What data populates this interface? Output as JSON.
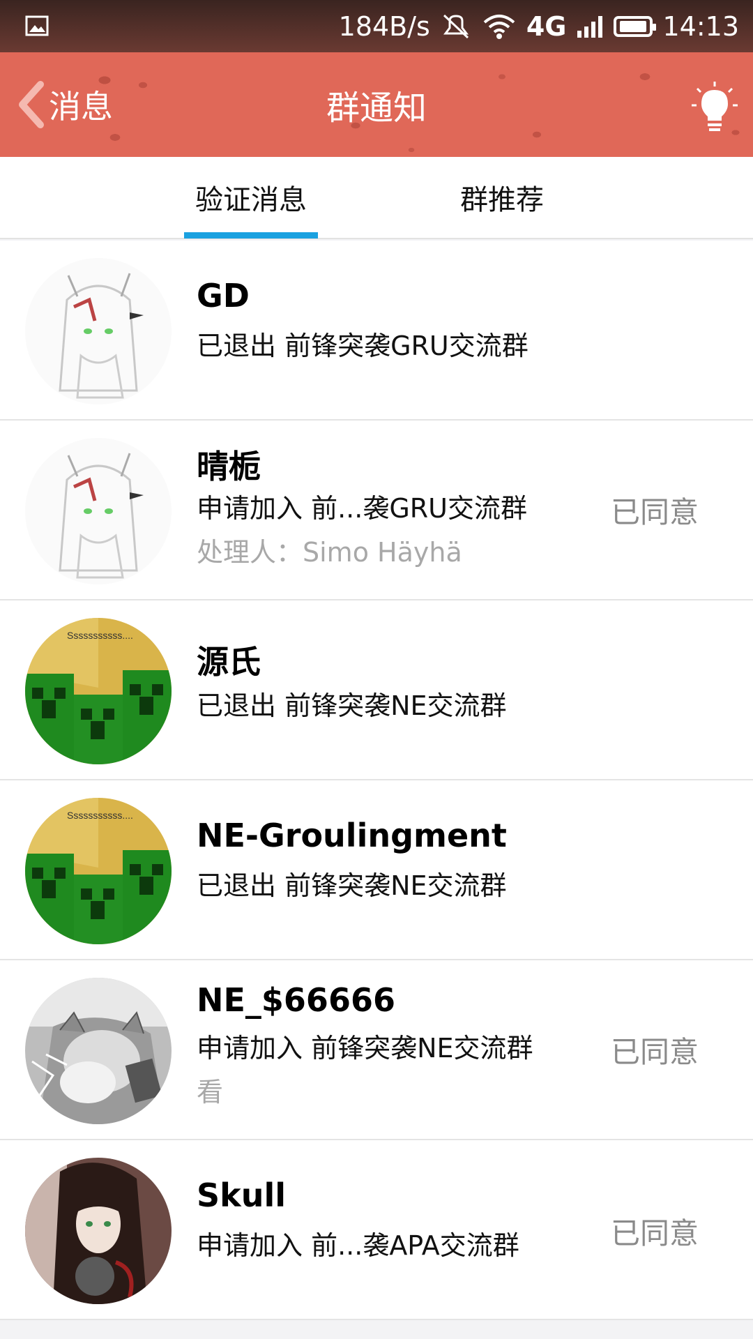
{
  "status_bar": {
    "net_speed": "184B/s",
    "network": "4G",
    "time": "14:13",
    "icons": [
      "image-notification-icon",
      "mute-icon",
      "wifi-icon",
      "signal-icon",
      "battery-icon"
    ]
  },
  "header": {
    "back_label": "消息",
    "title": "群通知",
    "right_icon": "lightbulb-icon",
    "color": "#e06858"
  },
  "tabs": [
    {
      "label": "验证消息",
      "active": true
    },
    {
      "label": "群推荐",
      "active": false
    }
  ],
  "accent_color": "#1aa1e0",
  "items": [
    {
      "name": "GD",
      "message": "已退出 前锋突袭GRU交流群",
      "handler": "",
      "status": "",
      "avatar": "anime-girl-sketch"
    },
    {
      "name": "晴栀",
      "message": "申请加入 前...袭GRU交流群",
      "handler": "处理人：Simo Häyhä",
      "status": "已同意",
      "avatar": "anime-girl-sketch"
    },
    {
      "name": "源氏",
      "message": "已退出 前锋突袭NE交流群",
      "handler": "",
      "status": "",
      "avatar": "creeper",
      "avatar_text": "Sssssssssss...."
    },
    {
      "name": "NE-Groulingment",
      "message": "已退出 前锋突袭NE交流群",
      "handler": "",
      "status": "",
      "avatar": "creeper",
      "avatar_text": "Sssssssssss...."
    },
    {
      "name": "NE_$66666",
      "message": "申请加入 前锋突袭NE交流群",
      "handler": "看",
      "status": "已同意",
      "avatar": "cat-phone"
    },
    {
      "name": "Skull",
      "message": "申请加入 前...袭APA交流群",
      "handler": "",
      "status": "已同意",
      "avatar": "dark-hair-girl"
    }
  ]
}
